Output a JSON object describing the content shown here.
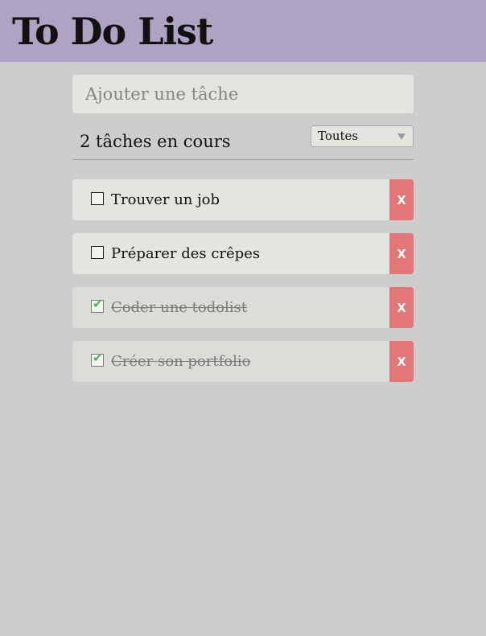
{
  "app": {
    "title": "To Do List"
  },
  "new_task": {
    "placeholder": "Ajouter une tâche"
  },
  "status": {
    "count_text": "2 tâches en cours"
  },
  "filter": {
    "selected": "Toutes"
  },
  "tasks": [
    {
      "label": "Trouver un job",
      "done": false,
      "delete_label": "X"
    },
    {
      "label": "Préparer des crêpes",
      "done": false,
      "delete_label": "X"
    },
    {
      "label": "Coder une todolist",
      "done": true,
      "delete_label": "X"
    },
    {
      "label": "Créer son portfolio",
      "done": true,
      "delete_label": "X"
    }
  ],
  "colors": {
    "header_bg": "#aea3c2",
    "page_bg": "#cdcdcd",
    "task_bg": "#e4e5de",
    "delete_bg": "#e37676",
    "check": "#4caf50"
  }
}
